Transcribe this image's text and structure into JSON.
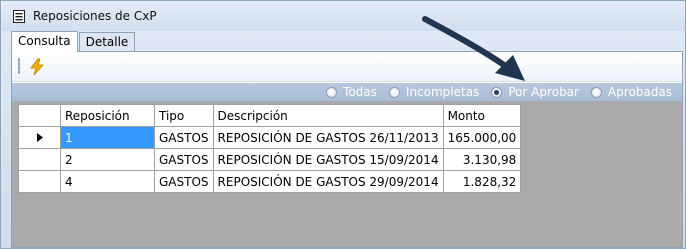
{
  "window": {
    "title": "Reposiciones de CxP",
    "icon": "list-document-icon"
  },
  "tabs": [
    {
      "label": "Consulta",
      "active": true
    },
    {
      "label": "Detalle",
      "active": false
    }
  ],
  "toolbar": {
    "run_icon": "lightning-bolt-icon"
  },
  "filters": {
    "options": [
      {
        "label": "Todas",
        "selected": false
      },
      {
        "label": "Incompletas",
        "selected": false
      },
      {
        "label": "Por Aprobar",
        "selected": true
      },
      {
        "label": "Aprobadas",
        "selected": false
      }
    ]
  },
  "grid": {
    "columns": [
      "Reposición",
      "Tipo",
      "Descripción",
      "Monto"
    ],
    "rows": [
      {
        "id": "1",
        "tipo": "GASTOS",
        "descripcion": "REPOSICIÓN DE GASTOS 26/11/2013",
        "monto": "165.000,00",
        "current": true
      },
      {
        "id": "2",
        "tipo": "GASTOS",
        "descripcion": "REPOSICIÓN DE GASTOS 15/09/2014",
        "monto": "3.130,98",
        "current": false
      },
      {
        "id": "4",
        "tipo": "GASTOS",
        "descripcion": "REPOSICIÓN DE GASTOS 29/09/2014",
        "monto": "1.828,32",
        "current": false
      }
    ]
  },
  "colors": {
    "selection": "#3399ff",
    "grid_background": "#aaaaaa",
    "annotation_arrow": "#1f3550"
  }
}
